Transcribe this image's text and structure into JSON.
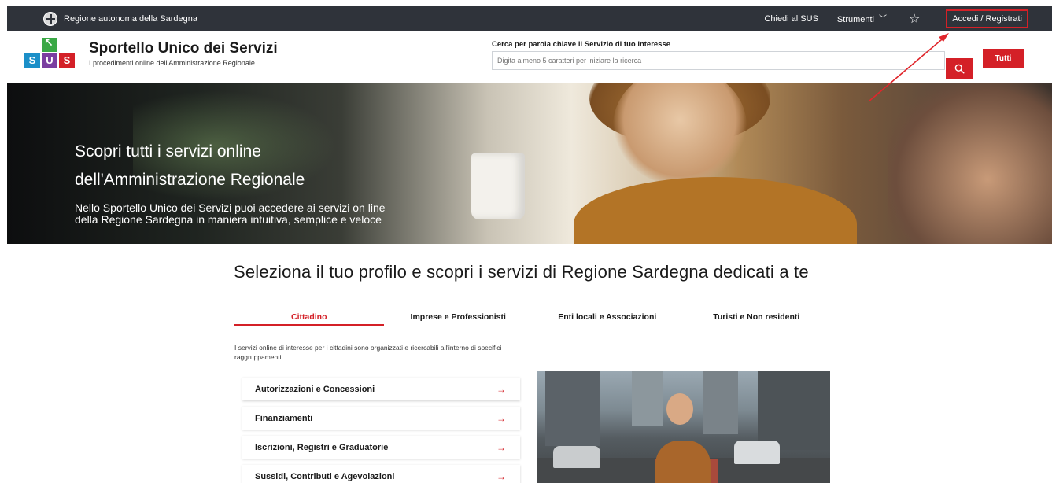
{
  "topbar": {
    "region_name": "Regione autonoma della Sardegna",
    "chiedi": "Chiedi al SUS",
    "strumenti": "Strumenti",
    "accedi": "Accedi / Registrati"
  },
  "header": {
    "logo_letters": [
      "S",
      "U",
      "S"
    ],
    "title": "Sportello Unico dei Servizi",
    "subtitle": "I procedimenti online dell'Amministrazione Regionale",
    "search_label": "Cerca per parola chiave il Servizio di tuo interesse",
    "search_placeholder": "Digita almeno 5 caratteri per iniziare la ricerca",
    "tutti": "Tutti"
  },
  "hero": {
    "line1": "Scopri tutti i servizi online",
    "line2": "dell'Amministrazione Regionale",
    "desc1": "Nello Sportello Unico dei Servizi puoi accedere ai servizi on line",
    "desc2": "della Regione Sardegna in maniera intuitiva, semplice e veloce"
  },
  "section": {
    "title": "Seleziona il tuo profilo e scopri i servizi di Regione Sardegna dedicati a te"
  },
  "tabs": [
    {
      "label": "Cittadino",
      "active": true
    },
    {
      "label": "Imprese e Professionisti",
      "active": false
    },
    {
      "label": "Enti locali e Associazioni",
      "active": false
    },
    {
      "label": "Turisti e Non residenti",
      "active": false
    }
  ],
  "intro": "I servizi online di interesse per i cittadini sono organizzati e ricercabili all'interno di specifici raggruppamenti",
  "services": [
    {
      "label": "Autorizzazioni e Concessioni"
    },
    {
      "label": "Finanziamenti"
    },
    {
      "label": "Iscrizioni, Registri e Graduatorie"
    },
    {
      "label": "Sussidi, Contributi e Agevolazioni"
    }
  ],
  "icons": {
    "arrow": "→",
    "chevron": "﹀",
    "star": "☆"
  },
  "colors": {
    "accent": "#d42027",
    "topbar": "#2f333a"
  }
}
